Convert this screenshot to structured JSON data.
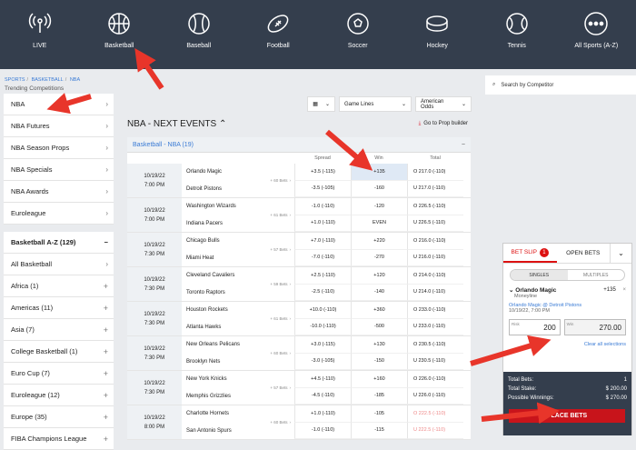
{
  "nav": [
    {
      "label": "LIVE",
      "icon": "live-icon"
    },
    {
      "label": "Basketball",
      "icon": "basketball-icon"
    },
    {
      "label": "Baseball",
      "icon": "baseball-icon"
    },
    {
      "label": "Football",
      "icon": "football-icon"
    },
    {
      "label": "Soccer",
      "icon": "soccer-icon"
    },
    {
      "label": "Hockey",
      "icon": "hockey-icon"
    },
    {
      "label": "Tennis",
      "icon": "tennis-icon"
    },
    {
      "label": "All Sports (A-Z)",
      "icon": "more-icon"
    }
  ],
  "breadcrumb": [
    "SPORTS",
    "BASKETBALL",
    "NBA"
  ],
  "sidebar": {
    "heading": "Trending Competitions",
    "items": [
      "NBA",
      "NBA Futures",
      "NBA Season Props",
      "NBA Specials",
      "NBA Awards",
      "Euroleague"
    ],
    "atoz_title": "Basketball A-Z (129)",
    "atoz_items": [
      "All Basketball",
      "Africa (1)",
      "Americas (11)",
      "Asia (7)",
      "College Basketball (1)",
      "Euro Cup (7)",
      "Euroleague (12)",
      "Europe (35)",
      "FIBA Champions League"
    ]
  },
  "toolbar": {
    "market": "Game Lines",
    "odds": "American Odds"
  },
  "main": {
    "title": "NBA - NEXT EVENTS",
    "prop_link": "Go to Prop builder",
    "competition": "Basketball - NBA (19)"
  },
  "columns": {
    "spread": "Spread",
    "win": "Win",
    "total": "Total"
  },
  "events": [
    {
      "date": "10/19/22",
      "time": "7:00 PM",
      "home": "Orlando Magic",
      "away": "Detroit Pistons",
      "bets": "+ 60 Bets",
      "s1": "+3.5 (-115)",
      "s2": "-3.5 (-105)",
      "w1": "+135",
      "w2": "-160",
      "t1": "O 217.0 (-110)",
      "t2": "U 217.0 (-110)"
    },
    {
      "date": "10/19/22",
      "time": "7:00 PM",
      "home": "Washington Wizards",
      "away": "Indiana Pacers",
      "bets": "+ 61 Bets",
      "s1": "-1.0 (-110)",
      "s2": "+1.0 (-110)",
      "w1": "-120",
      "w2": "EVEN",
      "t1": "O 226.5 (-110)",
      "t2": "U 226.5 (-110)"
    },
    {
      "date": "10/19/22",
      "time": "7:30 PM",
      "home": "Chicago Bulls",
      "away": "Miami Heat",
      "bets": "+ 57 Bets",
      "s1": "+7.0 (-110)",
      "s2": "-7.0 (-110)",
      "w1": "+220",
      "w2": "-270",
      "t1": "O 216.0 (-110)",
      "t2": "U 216.0 (-110)"
    },
    {
      "date": "10/19/22",
      "time": "7:30 PM",
      "home": "Cleveland Cavaliers",
      "away": "Toronto Raptors",
      "bets": "+ 59 Bets",
      "s1": "+2.5 (-110)",
      "s2": "-2.5 (-110)",
      "w1": "+120",
      "w2": "-140",
      "t1": "O 214.0 (-110)",
      "t2": "U 214.0 (-110)"
    },
    {
      "date": "10/19/22",
      "time": "7:30 PM",
      "home": "Houston Rockets",
      "away": "Atlanta Hawks",
      "bets": "+ 61 Bets",
      "s1": "+10.0 (-110)",
      "s2": "-10.0 (-110)",
      "w1": "+360",
      "w2": "-500",
      "t1": "O 233.0 (-110)",
      "t2": "U 233.0 (-110)"
    },
    {
      "date": "10/19/22",
      "time": "7:30 PM",
      "home": "New Orleans Pelicans",
      "away": "Brooklyn Nets",
      "bets": "+ 60 Bets",
      "s1": "+3.0 (-115)",
      "s2": "-3.0 (-105)",
      "w1": "+130",
      "w2": "-150",
      "t1": "O 230.5 (-110)",
      "t2": "U 230.5 (-110)"
    },
    {
      "date": "10/19/22",
      "time": "7:30 PM",
      "home": "New York Knicks",
      "away": "Memphis Grizzlies",
      "bets": "+ 57 Bets",
      "s1": "+4.5 (-110)",
      "s2": "-4.5 (-110)",
      "w1": "+160",
      "w2": "-185",
      "t1": "O 226.0 (-110)",
      "t2": "U 226.0 (-110)"
    },
    {
      "date": "10/19/22",
      "time": "8:00 PM",
      "home": "Charlotte Hornets",
      "away": "San Antonio Spurs",
      "bets": "+ 60 Bets",
      "s1": "+1.0 (-110)",
      "s2": "-1.0 (-110)",
      "w1": "-105",
      "w2": "-115",
      "t1": "O 222.5 (-110)",
      "t2": "U 222.5 (-110)"
    }
  ],
  "search_placeholder": "Search by Competitor",
  "betslip": {
    "tab1": "BET SLIP",
    "count": "1",
    "tab2": "OPEN BETS",
    "singles": "SINGLES",
    "multiples": "MULTIPLES",
    "selection": "Orlando Magic",
    "market": "Moneyline",
    "odds": "+135",
    "match": "Orlando Magic @ Detroit Pistons",
    "time": "10/19/22, 7:00 PM",
    "risk_label": "Risk",
    "risk": "200",
    "win_label": "Win",
    "win": "270.00",
    "clear": "Clear all selections",
    "total_bets_label": "Total Bets:",
    "total_bets": "1",
    "total_stake_label": "Total Stake:",
    "total_stake": "$ 200.00",
    "possible_label": "Possible Winnings:",
    "possible": "$ 270.00",
    "place": "PLACE BETS"
  },
  "colors": {
    "nav_bg": "#343e4d",
    "accent": "#c8141b",
    "link": "#3a7bd5",
    "arrow": "#e8352a"
  }
}
